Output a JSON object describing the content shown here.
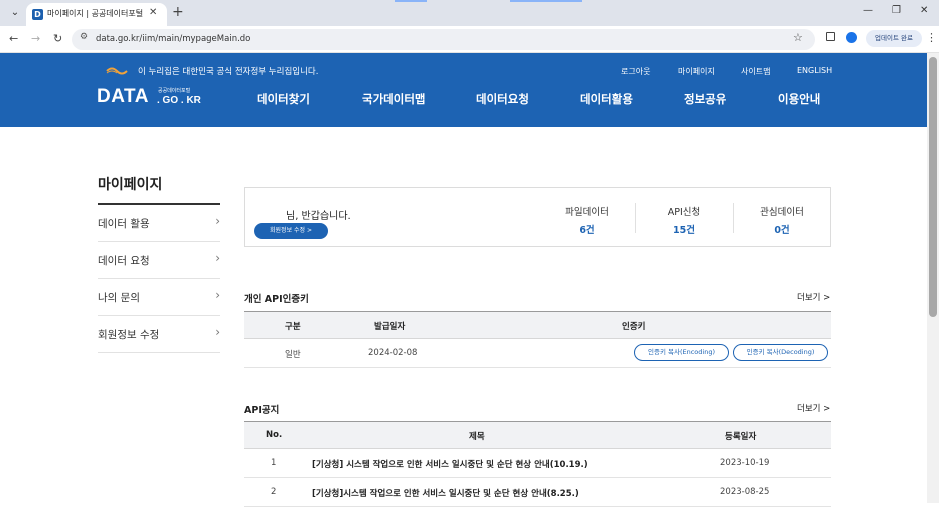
{
  "browser": {
    "tab_title": "마이페이지 | 공공데이터포털",
    "tab_favicon_letter": "D",
    "url": "data.go.kr/iim/main/mypageMain.do",
    "update_label": "업데이트 완료"
  },
  "header": {
    "gov_notice": "이 누리집은 대한민국 공식 전자정부 누리집입니다.",
    "util_links": [
      "로그아웃",
      "마이페이지",
      "사이트맵",
      "ENGLISH"
    ],
    "logo_main": "DATA",
    "logo_sub": "공공데이터포털",
    "logo_sub2": ". GO . KR",
    "nav": [
      "데이터찾기",
      "국가데이터맵",
      "데이터요청",
      "데이터활용",
      "정보공유",
      "이용안내"
    ],
    "brand_color": "#1d63b3"
  },
  "sidebar": {
    "title": "마이페이지",
    "items": [
      "데이터 활용",
      "데이터 요청",
      "나의 문의",
      "회원정보 수정"
    ]
  },
  "summary": {
    "greeting": "님, 반갑습니다.",
    "edit_button": "회원정보 수정 >",
    "stats": [
      {
        "label": "파일데이터",
        "value": "6건"
      },
      {
        "label": "API신청",
        "value": "15건"
      },
      {
        "label": "관심데이터",
        "value": "0건"
      }
    ]
  },
  "api_key": {
    "title": "개인 API인증키",
    "more": "더보기 >",
    "headers": [
      "구분",
      "발급일자",
      "인증키"
    ],
    "rows": [
      {
        "type": "일반",
        "date": "2024-02-08",
        "btn_encoding": "인증키 복사(Encoding)",
        "btn_decoding": "인증키 복사(Decoding)"
      }
    ]
  },
  "api_notice": {
    "title": "API공지",
    "more": "더보기 >",
    "headers": [
      "No.",
      "제목",
      "등록일자"
    ],
    "rows": [
      {
        "no": "1",
        "title": "[기상청] 시스템 작업으로 인한 서비스 일시중단 및 순단 현상 안내(10.19.)",
        "date": "2023-10-19"
      },
      {
        "no": "2",
        "title": "[기상청]시스템 작업으로 인한 서비스 일시중단 및 순단 현상 안내(8.25.)",
        "date": "2023-08-25"
      }
    ]
  }
}
